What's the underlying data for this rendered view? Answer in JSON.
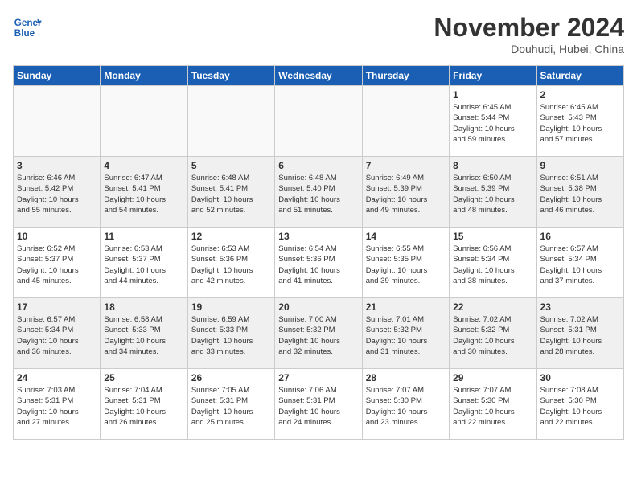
{
  "header": {
    "logo_line1": "General",
    "logo_line2": "Blue",
    "month": "November 2024",
    "location": "Douhudi, Hubei, China"
  },
  "weekdays": [
    "Sunday",
    "Monday",
    "Tuesday",
    "Wednesday",
    "Thursday",
    "Friday",
    "Saturday"
  ],
  "weeks": [
    [
      {
        "day": "",
        "info": ""
      },
      {
        "day": "",
        "info": ""
      },
      {
        "day": "",
        "info": ""
      },
      {
        "day": "",
        "info": ""
      },
      {
        "day": "",
        "info": ""
      },
      {
        "day": "1",
        "info": "Sunrise: 6:45 AM\nSunset: 5:44 PM\nDaylight: 10 hours\nand 59 minutes."
      },
      {
        "day": "2",
        "info": "Sunrise: 6:45 AM\nSunset: 5:43 PM\nDaylight: 10 hours\nand 57 minutes."
      }
    ],
    [
      {
        "day": "3",
        "info": "Sunrise: 6:46 AM\nSunset: 5:42 PM\nDaylight: 10 hours\nand 55 minutes."
      },
      {
        "day": "4",
        "info": "Sunrise: 6:47 AM\nSunset: 5:41 PM\nDaylight: 10 hours\nand 54 minutes."
      },
      {
        "day": "5",
        "info": "Sunrise: 6:48 AM\nSunset: 5:41 PM\nDaylight: 10 hours\nand 52 minutes."
      },
      {
        "day": "6",
        "info": "Sunrise: 6:48 AM\nSunset: 5:40 PM\nDaylight: 10 hours\nand 51 minutes."
      },
      {
        "day": "7",
        "info": "Sunrise: 6:49 AM\nSunset: 5:39 PM\nDaylight: 10 hours\nand 49 minutes."
      },
      {
        "day": "8",
        "info": "Sunrise: 6:50 AM\nSunset: 5:39 PM\nDaylight: 10 hours\nand 48 minutes."
      },
      {
        "day": "9",
        "info": "Sunrise: 6:51 AM\nSunset: 5:38 PM\nDaylight: 10 hours\nand 46 minutes."
      }
    ],
    [
      {
        "day": "10",
        "info": "Sunrise: 6:52 AM\nSunset: 5:37 PM\nDaylight: 10 hours\nand 45 minutes."
      },
      {
        "day": "11",
        "info": "Sunrise: 6:53 AM\nSunset: 5:37 PM\nDaylight: 10 hours\nand 44 minutes."
      },
      {
        "day": "12",
        "info": "Sunrise: 6:53 AM\nSunset: 5:36 PM\nDaylight: 10 hours\nand 42 minutes."
      },
      {
        "day": "13",
        "info": "Sunrise: 6:54 AM\nSunset: 5:36 PM\nDaylight: 10 hours\nand 41 minutes."
      },
      {
        "day": "14",
        "info": "Sunrise: 6:55 AM\nSunset: 5:35 PM\nDaylight: 10 hours\nand 39 minutes."
      },
      {
        "day": "15",
        "info": "Sunrise: 6:56 AM\nSunset: 5:34 PM\nDaylight: 10 hours\nand 38 minutes."
      },
      {
        "day": "16",
        "info": "Sunrise: 6:57 AM\nSunset: 5:34 PM\nDaylight: 10 hours\nand 37 minutes."
      }
    ],
    [
      {
        "day": "17",
        "info": "Sunrise: 6:57 AM\nSunset: 5:34 PM\nDaylight: 10 hours\nand 36 minutes."
      },
      {
        "day": "18",
        "info": "Sunrise: 6:58 AM\nSunset: 5:33 PM\nDaylight: 10 hours\nand 34 minutes."
      },
      {
        "day": "19",
        "info": "Sunrise: 6:59 AM\nSunset: 5:33 PM\nDaylight: 10 hours\nand 33 minutes."
      },
      {
        "day": "20",
        "info": "Sunrise: 7:00 AM\nSunset: 5:32 PM\nDaylight: 10 hours\nand 32 minutes."
      },
      {
        "day": "21",
        "info": "Sunrise: 7:01 AM\nSunset: 5:32 PM\nDaylight: 10 hours\nand 31 minutes."
      },
      {
        "day": "22",
        "info": "Sunrise: 7:02 AM\nSunset: 5:32 PM\nDaylight: 10 hours\nand 30 minutes."
      },
      {
        "day": "23",
        "info": "Sunrise: 7:02 AM\nSunset: 5:31 PM\nDaylight: 10 hours\nand 28 minutes."
      }
    ],
    [
      {
        "day": "24",
        "info": "Sunrise: 7:03 AM\nSunset: 5:31 PM\nDaylight: 10 hours\nand 27 minutes."
      },
      {
        "day": "25",
        "info": "Sunrise: 7:04 AM\nSunset: 5:31 PM\nDaylight: 10 hours\nand 26 minutes."
      },
      {
        "day": "26",
        "info": "Sunrise: 7:05 AM\nSunset: 5:31 PM\nDaylight: 10 hours\nand 25 minutes."
      },
      {
        "day": "27",
        "info": "Sunrise: 7:06 AM\nSunset: 5:31 PM\nDaylight: 10 hours\nand 24 minutes."
      },
      {
        "day": "28",
        "info": "Sunrise: 7:07 AM\nSunset: 5:30 PM\nDaylight: 10 hours\nand 23 minutes."
      },
      {
        "day": "29",
        "info": "Sunrise: 7:07 AM\nSunset: 5:30 PM\nDaylight: 10 hours\nand 22 minutes."
      },
      {
        "day": "30",
        "info": "Sunrise: 7:08 AM\nSunset: 5:30 PM\nDaylight: 10 hours\nand 22 minutes."
      }
    ]
  ]
}
